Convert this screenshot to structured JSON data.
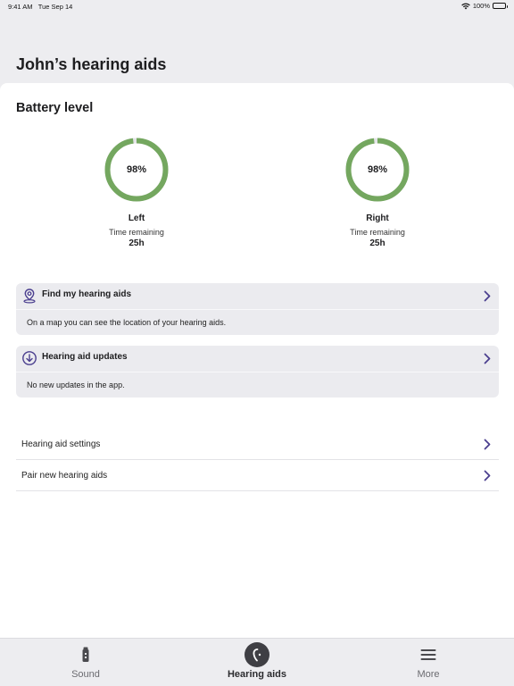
{
  "status": {
    "time": "9:41 AM",
    "date": "Tue Sep 14",
    "battery": "100%"
  },
  "page": {
    "title": "John’s hearing aids"
  },
  "battery": {
    "section_title": "Battery level",
    "ring_color": "#74a75f",
    "left": {
      "percent": "98%",
      "level": 0.98,
      "side": "Left",
      "time_label": "Time remaining",
      "time_value": "25h"
    },
    "right": {
      "percent": "98%",
      "level": 0.98,
      "side": "Right",
      "time_label": "Time remaining",
      "time_value": "25h"
    }
  },
  "cards": [
    {
      "icon": "location-pin-icon",
      "title": "Find my hearing aids",
      "body": "On a map you can see the location of your hearing aids."
    },
    {
      "icon": "download-circle-icon",
      "title": "Hearing aid updates",
      "body": "No new updates in the app."
    }
  ],
  "list": [
    {
      "label": "Hearing aid settings"
    },
    {
      "label": "Pair new hearing aids"
    }
  ],
  "tabs": [
    {
      "label": "Sound",
      "icon": "remote-control-icon",
      "active": false
    },
    {
      "label": "Hearing aids",
      "icon": "hearing-aid-icon",
      "active": true
    },
    {
      "label": "More",
      "icon": "menu-icon",
      "active": false
    }
  ],
  "colors": {
    "accent": "#4b3f8f",
    "battery_ring": "#74a75f"
  }
}
